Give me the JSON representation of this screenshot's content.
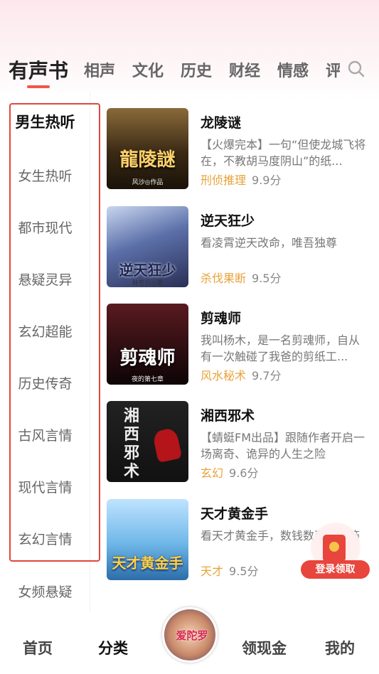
{
  "tabs": [
    {
      "label": "有声书",
      "active": true
    },
    {
      "label": "相声"
    },
    {
      "label": "文化"
    },
    {
      "label": "历史"
    },
    {
      "label": "财经"
    },
    {
      "label": "情感"
    },
    {
      "label": "评"
    }
  ],
  "sidebar": {
    "items": [
      {
        "label": "男生热听",
        "active": true
      },
      {
        "label": "女生热听"
      },
      {
        "label": "都市现代"
      },
      {
        "label": "悬疑灵异"
      },
      {
        "label": "玄幻超能"
      },
      {
        "label": "历史传奇"
      },
      {
        "label": "古风言情"
      },
      {
        "label": "现代言情"
      },
      {
        "label": "玄幻言情"
      },
      {
        "label": "女频悬疑"
      }
    ]
  },
  "books": [
    {
      "title": "龙陵谜",
      "desc": "【火爆完本】一句“但使龙城飞将在，不教胡马度阴山”的纸...",
      "tag": "刑侦推理",
      "score": "9.9分",
      "cover_title": "龍陵謎",
      "cover_sub": "风沙◎作品",
      "cover_color": "#3a2a14"
    },
    {
      "title": "逆天狂少",
      "desc": "看凌霄逆天改命，唯吾独尊",
      "tag": "杀伐果断",
      "score": "9.5分",
      "cover_title": "逆天狂少",
      "cover_sub": "林苍白◎著",
      "cover_color": "#5b6fa8"
    },
    {
      "title": "剪魂师",
      "desc": "我叫杨木，是一名剪魂师，自从有一次触碰了我爸的剪纸工...",
      "tag": "风水秘术",
      "score": "9.7分",
      "cover_title": "剪魂师",
      "cover_sub": "夜的第七章",
      "cover_color": "#2a0d10"
    },
    {
      "title": "湘西邪术",
      "desc": "【蜻蜓FM出品】跟随作者开启一场离奇、诡异的人生之险",
      "tag": "玄幻",
      "score": "9.6分",
      "cover_title": "湘西邪术",
      "cover_sub": "",
      "cover_color": "#111111"
    },
    {
      "title": "天才黄金手",
      "desc": "看天才黄金手，数钱数到手抽筋",
      "tag": "天才",
      "score": "9.5分",
      "cover_title": "天才黄金手",
      "cover_sub": "",
      "cover_color": "#6fb7e8"
    }
  ],
  "reward": {
    "label": "登录领取"
  },
  "bottom_nav": [
    {
      "label": "首页"
    },
    {
      "label": "分类",
      "active": true
    },
    {
      "label": "领现金"
    },
    {
      "label": "我的"
    }
  ],
  "player": {
    "cover_text": "爱陀罗"
  },
  "colors": {
    "accent": "#f0564a",
    "tag": "#e8a33a",
    "highlight_border": "#e0473d"
  },
  "icons": {
    "search": "search-icon"
  }
}
